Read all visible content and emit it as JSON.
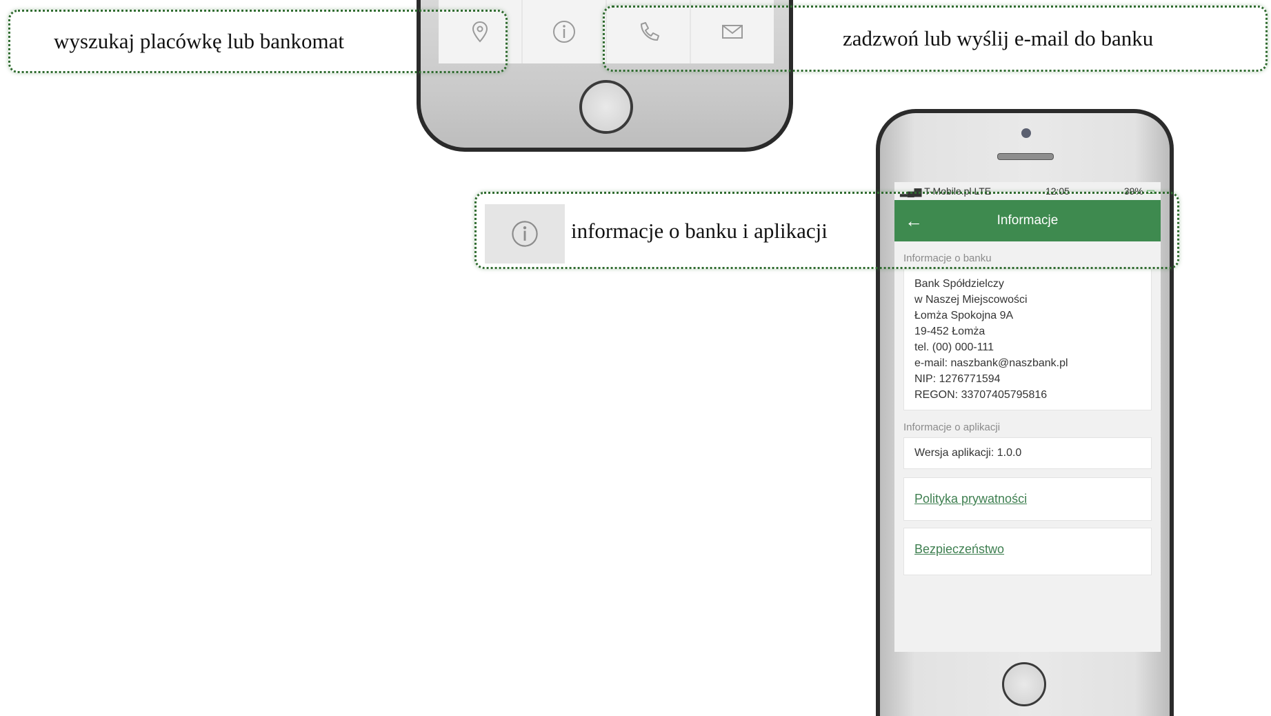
{
  "callouts": {
    "search": "wyszukaj placówkę lub bankomat",
    "contact": "zadzwoń lub wyślij e-mail do banku",
    "info": "informacje o banku i aplikacji"
  },
  "top_toolbar": {
    "icons": [
      "map-pin-icon",
      "info-icon",
      "phone-icon",
      "mail-icon"
    ]
  },
  "status_bar": {
    "carrier": "T-Mobile.pl  LTE",
    "time": "12:05",
    "battery": "39%"
  },
  "app_bar": {
    "back_icon": "back-arrow-icon",
    "title": "Informacje"
  },
  "bank_info": {
    "section_label": "Informacje o banku",
    "lines": [
      "Bank Spółdzielczy",
      "w Naszej Miejscowości",
      "Łomża Spokojna 9A",
      "19-452 Łomża",
      "tel. (00) 000-111",
      "e-mail: naszbank@naszbank.pl",
      "NIP: 1276771594",
      "REGON: 33707405795816"
    ]
  },
  "app_info": {
    "section_label": "Informacje o aplikacji",
    "version": "Wersja aplikacji: 1.0.0"
  },
  "links": {
    "privacy": "Polityka prywatności",
    "security": "Bezpieczeństwo"
  },
  "colors": {
    "accent_green": "#3e8a4f",
    "callout_border": "#2f6b2f",
    "link_green": "#3e7f50"
  }
}
